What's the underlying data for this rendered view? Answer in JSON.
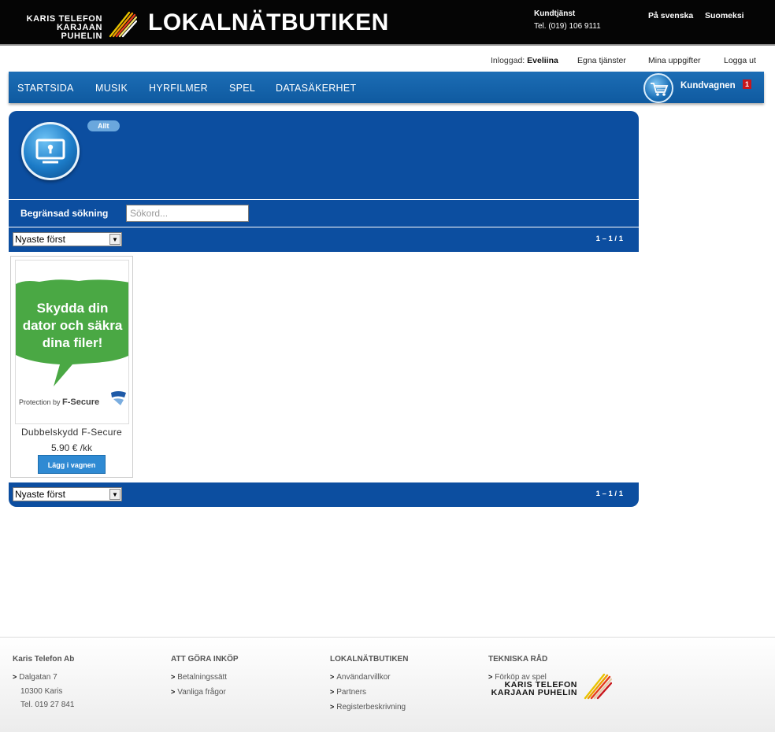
{
  "header": {
    "brand_line1": "KARIS TELEFON",
    "brand_line2": "KARJAAN PUHELIN",
    "site_title": "LOKALNÄTBUTIKEN",
    "support_label": "Kundtjänst",
    "support_phone": "Tel. (019) 106 9111",
    "lang_sv": "På svenska",
    "lang_fi": "Suomeksi"
  },
  "userbar": {
    "logged_in_label": "Inloggad:",
    "user_name": "Eveliina",
    "my_services": "Egna tjänster",
    "my_info": "Mina uppgifter",
    "logout": "Logga ut"
  },
  "nav": {
    "items": [
      "STARTSIDA",
      "MUSIK",
      "HYRFILMER",
      "SPEL",
      "DATASÄKERHET"
    ],
    "cart_label": "Kundvagnen",
    "cart_count": "1",
    "cart_icon": "shopping-cart-icon"
  },
  "category": {
    "icon": "monitor-lock-icon",
    "filter_all": "Allt",
    "search_label": "Begränsad sökning",
    "search_placeholder": "Sökord...",
    "sort_selected": "Nyaste först",
    "pager_text": "1 – 1 / 1"
  },
  "products": [
    {
      "image_text": "Skydda din dator och säkra dina filer!",
      "image_brand": "Protection by F-Secure",
      "name": "Dubbelskydd F-Secure",
      "price": "5.90 € /kk",
      "add_label": "Lägg i vagnen"
    }
  ],
  "footer": {
    "col1": {
      "title": "Karis Telefon Ab",
      "address1": "Dalgatan 7",
      "address2": "10300 Karis",
      "phone": "Tel. 019 27 841"
    },
    "col2": {
      "title": "ATT GÖRA INKÖP",
      "links": [
        "Betalningssätt",
        "Vanliga frågor"
      ]
    },
    "col3": {
      "title": "LOKALNÄTBUTIKEN",
      "links": [
        "Användarvillkor",
        "Partners",
        "Registerbeskrivning"
      ]
    },
    "col4": {
      "title": "TEKNISKA RÅD",
      "links": [
        "Förköp av spel"
      ],
      "brand_line1": "KARIS TELEFON",
      "brand_line2": "KARJAAN PUHELIN"
    }
  },
  "colors": {
    "nav_blue": "#1c6db5",
    "panel_blue": "#0c4ea0",
    "header_black": "#050505",
    "button_blue": "#2f8ad3",
    "promo_green": "#4aa844"
  }
}
